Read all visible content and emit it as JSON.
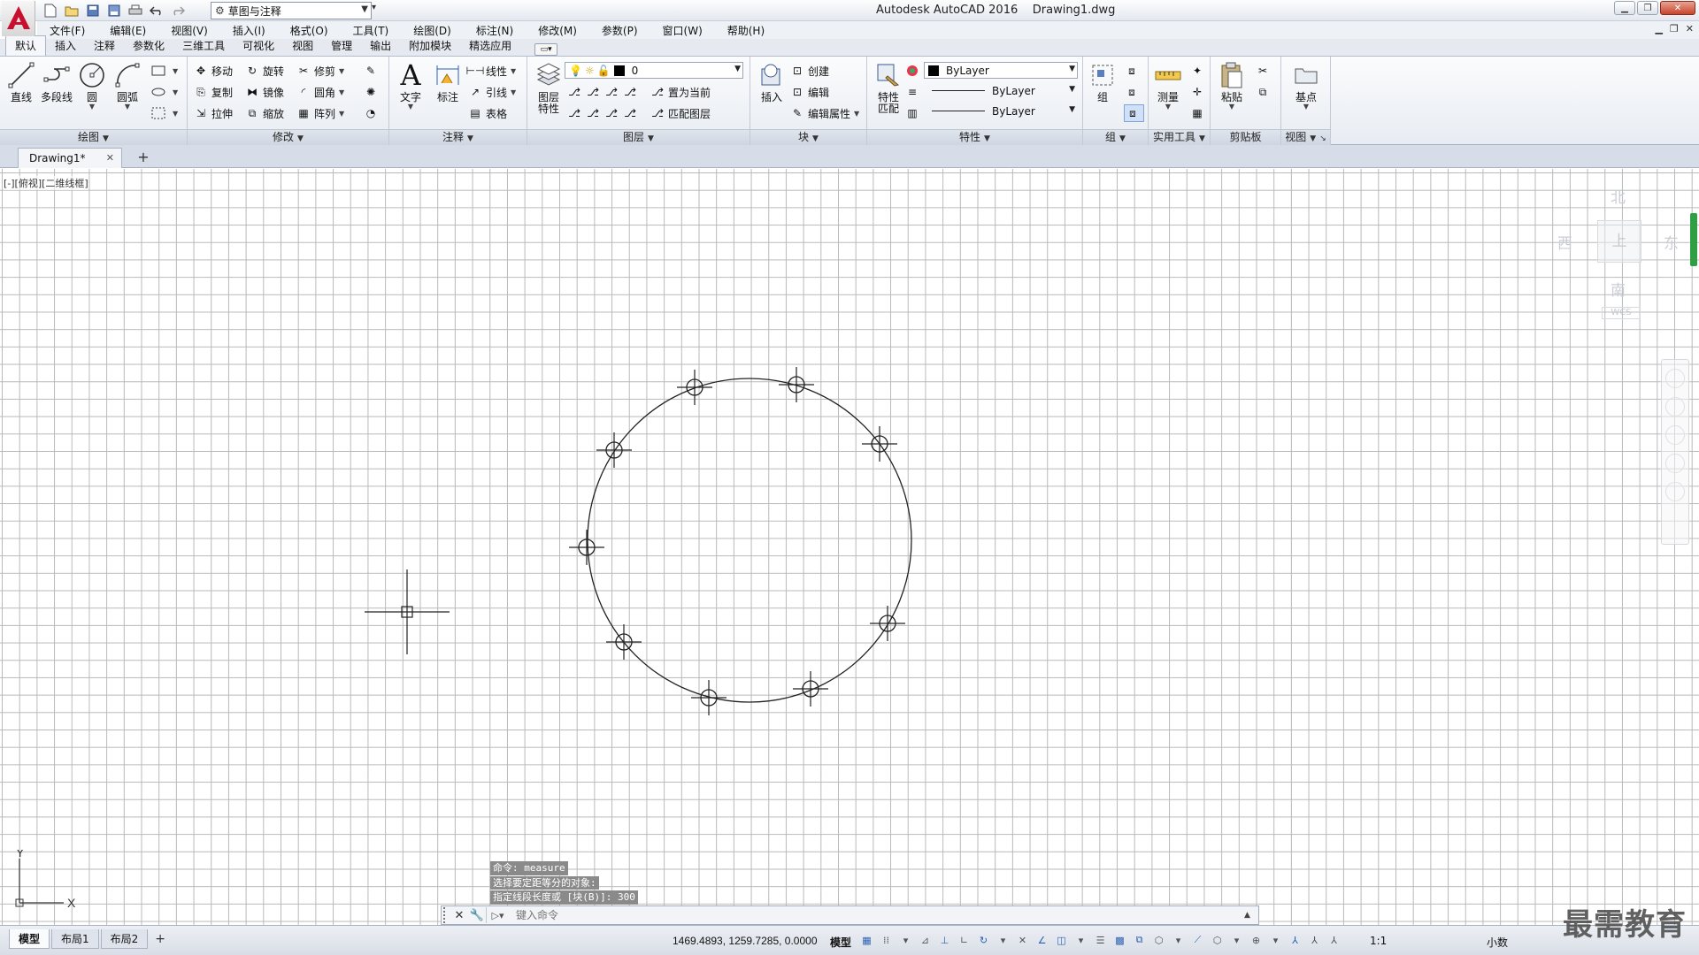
{
  "window": {
    "title": "Autodesk AutoCAD 2016    Drawing1.dwg",
    "workspace": "草图与注释"
  },
  "menus": [
    "文件(F)",
    "编辑(E)",
    "视图(V)",
    "插入(I)",
    "格式(O)",
    "工具(T)",
    "绘图(D)",
    "标注(N)",
    "修改(M)",
    "参数(P)",
    "窗口(W)",
    "帮助(H)"
  ],
  "ribbon_tabs": [
    "默认",
    "插入",
    "注释",
    "参数化",
    "三维工具",
    "可视化",
    "视图",
    "管理",
    "输出",
    "附加模块",
    "精选应用"
  ],
  "ribbon": {
    "draw": {
      "title": "绘图",
      "line": "直线",
      "polyline": "多段线",
      "circle": "圆",
      "arc": "圆弧"
    },
    "modify": {
      "title": "修改",
      "move": "移动",
      "rotate": "旋转",
      "trim": "修剪",
      "copy": "复制",
      "mirror": "镜像",
      "fillet": "圆角",
      "stretch": "拉伸",
      "scale": "缩放",
      "array": "阵列"
    },
    "annotation": {
      "title": "注释",
      "text": "文字",
      "dimension": "标注",
      "linear": "线性",
      "leader": "引线",
      "table": "表格"
    },
    "layers": {
      "title": "图层",
      "layer_props": "图层\n特性",
      "current_layer": "0",
      "make_current": "置为当前",
      "match_layer": "匹配图层"
    },
    "block": {
      "title": "块",
      "insert": "插入",
      "create": "创建",
      "edit": "编辑",
      "edit_attr": "编辑属性"
    },
    "properties": {
      "title": "特性",
      "match": "特性\n匹配",
      "color": "ByLayer",
      "linetype": "ByLayer",
      "lineweight": "ByLayer"
    },
    "groups": {
      "title": "组",
      "group": "组"
    },
    "utilities": {
      "title": "实用工具",
      "measure": "测量"
    },
    "clipboard": {
      "title": "剪贴板",
      "paste": "粘贴"
    },
    "view": {
      "title": "视图",
      "base": "基点"
    }
  },
  "doc_tab": "Drawing1*",
  "viewport_label": "[-][俯视][二维线框]",
  "viewcube": {
    "north": "北",
    "south": "南",
    "east": "东",
    "west": "西",
    "face": "上",
    "wcs": "WCS"
  },
  "ucs": {
    "x": "X",
    "y": "Y"
  },
  "command_history": [
    "命令:  measure",
    "选择要定距等分的对象:",
    "指定线段长度或 [块(B)]: 300"
  ],
  "command_placeholder": "键入命令",
  "layout_tabs": [
    "模型",
    "布局1",
    "布局2"
  ],
  "status": {
    "coords": "1469.4893, 1259.7285, 0.0000",
    "space": "模型",
    "scale": "1:1",
    "units": "小数"
  },
  "watermark": "最需教育",
  "colors": {
    "accent": "#2b5fb3",
    "grid": "#b9b9b9",
    "command_bg": "#8a8a8a",
    "logo_red": "#c8102e"
  }
}
